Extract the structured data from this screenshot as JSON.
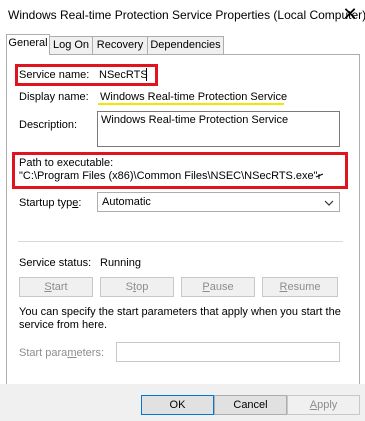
{
  "window": {
    "title": "Windows Real-time Protection Service Properties (Local Computer)",
    "close_glyph": "✕"
  },
  "tabs": [
    {
      "label": "General",
      "active": true
    },
    {
      "label": "Log On",
      "active": false
    },
    {
      "label": "Recovery",
      "active": false
    },
    {
      "label": "Dependencies",
      "active": false
    }
  ],
  "general": {
    "service_name_label": "Service name:",
    "service_name_value": "NSecRTS",
    "display_name_label": "Display name:",
    "display_name_value": "Windows Real-time Protection Service",
    "description_label": "Description:",
    "description_value": "Windows Real-time Protection Service",
    "path_label": "Path to executable:",
    "path_value": "\"C:\\Program Files (x86)\\Common Files\\NSEC\\NSecRTS.exe\"",
    "startup_type_label_pre": "Startup typ",
    "startup_type_label_u": "e",
    "startup_type_label_post": ":",
    "startup_type_value": "Automatic",
    "service_status_label": "Service status:",
    "service_status_value": "Running",
    "start_pre": "",
    "start_u": "S",
    "start_post": "tart",
    "stop_pre": "S",
    "stop_u": "t",
    "stop_post": "op",
    "pause_pre": "",
    "pause_u": "P",
    "pause_post": "ause",
    "resume_pre": "",
    "resume_u": "R",
    "resume_post": "esume",
    "hint_text": "You can specify the start parameters that apply when you start the service from here.",
    "start_params_label_pre": "Start para",
    "start_params_label_u": "m",
    "start_params_label_post": "eters:",
    "start_params_value": ""
  },
  "footer": {
    "ok_label": "OK",
    "cancel_label": "Cancel",
    "apply_pre": "",
    "apply_u": "A",
    "apply_post": "pply"
  },
  "colors": {
    "highlight_red": "#e0141e",
    "highlight_yellow": "#f2e600",
    "default_button_border": "#0078d7"
  }
}
